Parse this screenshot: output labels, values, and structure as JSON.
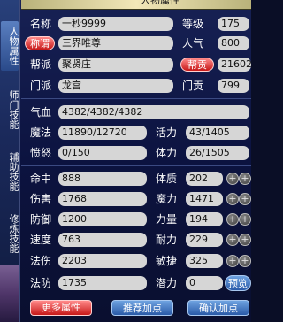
{
  "window": {
    "title": "人物属性"
  },
  "left_tabs": [
    {
      "label": "人物属性"
    },
    {
      "label": "师门技能"
    },
    {
      "label": "辅助技能"
    },
    {
      "label": "修炼技能"
    }
  ],
  "info": {
    "name_label": "名称",
    "name_value": "一秒9999",
    "level_label": "等级",
    "level_value": "175",
    "title_btn": "称谓",
    "title_value": "三界唯尊",
    "popularity_label": "人气",
    "popularity_value": "800",
    "faction_label": "帮派",
    "faction_value": "聚贤庄",
    "contrib_btn": "帮贡",
    "contrib_value": "21602",
    "school_label": "门派",
    "school_value": "龙宫",
    "school_contrib_label": "门贡",
    "school_contrib_value": "799"
  },
  "vitals": {
    "hp_label": "气血",
    "hp_value": "4382/4382/4382",
    "mp_label": "魔法",
    "mp_value": "11890/12720",
    "vigor_label": "活力",
    "vigor_value": "43/1405",
    "rage_label": "愤怒",
    "rage_value": "0/150",
    "stamina_label": "体力",
    "stamina_value": "26/1505"
  },
  "stats": [
    {
      "label": "命中",
      "value": "888",
      "attr_label": "体质",
      "attr_value": "202"
    },
    {
      "label": "伤害",
      "value": "1768",
      "attr_label": "魔力",
      "attr_value": "1471"
    },
    {
      "label": "防御",
      "value": "1200",
      "attr_label": "力量",
      "attr_value": "194"
    },
    {
      "label": "速度",
      "value": "763",
      "attr_label": "耐力",
      "attr_value": "229"
    },
    {
      "label": "法伤",
      "value": "2203",
      "attr_label": "敏捷",
      "attr_value": "325"
    },
    {
      "label": "法防",
      "value": "1735",
      "attr_label": "潜力",
      "attr_value": "0"
    }
  ],
  "preview_btn": "预览",
  "footer": {
    "more_btn": "更多属性",
    "recommend_btn": "推荐加点",
    "confirm_btn": "确认加点"
  }
}
